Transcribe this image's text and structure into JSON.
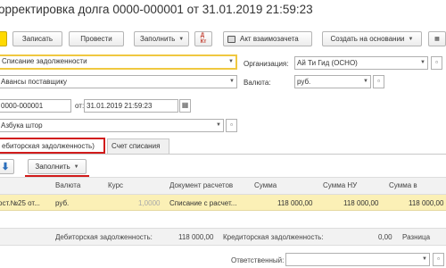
{
  "window": {
    "title": "орректировка долга 0000-000001 от 31.01.2019 21:59:23"
  },
  "toolbar": {
    "post_close_label": "",
    "save_label": "Записать",
    "post_label": "Провести",
    "fill_label": "Заполнить",
    "act_label": "Акт взаимозачета",
    "create_basis_label": "Создать на основании"
  },
  "form": {
    "operation_type": "Списание задолженности",
    "debt_type": "Авансы поставщику",
    "number": "0000-000001",
    "date_label": "от:",
    "date": "31.01.2019 21:59:23",
    "counterparty": "Азбука штор",
    "organization_label": "Организация:",
    "organization": "Ай Ти Гид (ОСНО)",
    "currency_label": "Валюта:",
    "currency": "руб."
  },
  "tabs": [
    {
      "label": "ебиторская задолженность)"
    },
    {
      "label": "Счет списания"
    }
  ],
  "table_toolbar": {
    "fill_label": "Заполнить"
  },
  "table": {
    "headers": [
      "Валюта",
      "Курс",
      "Документ расчетов",
      "Сумма",
      "Сумма НУ",
      "Сумма в"
    ],
    "rows": [
      {
        "doc": "ост.№25 от...",
        "currency": "руб.",
        "rate": "1,0000",
        "settlement": "Списание с расчет...",
        "sum": "118 000,00",
        "sum_nu": "118 000,00",
        "sum_v": "118 000,00"
      }
    ]
  },
  "footer": {
    "debit_label": "Дебиторская задолженность:",
    "debit_value": "118 000,00",
    "credit_label": "Кредиторская задолженность:",
    "credit_value": "0,00",
    "diff_label": "Разница",
    "responsible_label": "Ответственный:"
  },
  "colors": {
    "yellow": "#ffd900",
    "red_outline": "#d11b1b",
    "row_highlight": "#fbf0b6"
  }
}
